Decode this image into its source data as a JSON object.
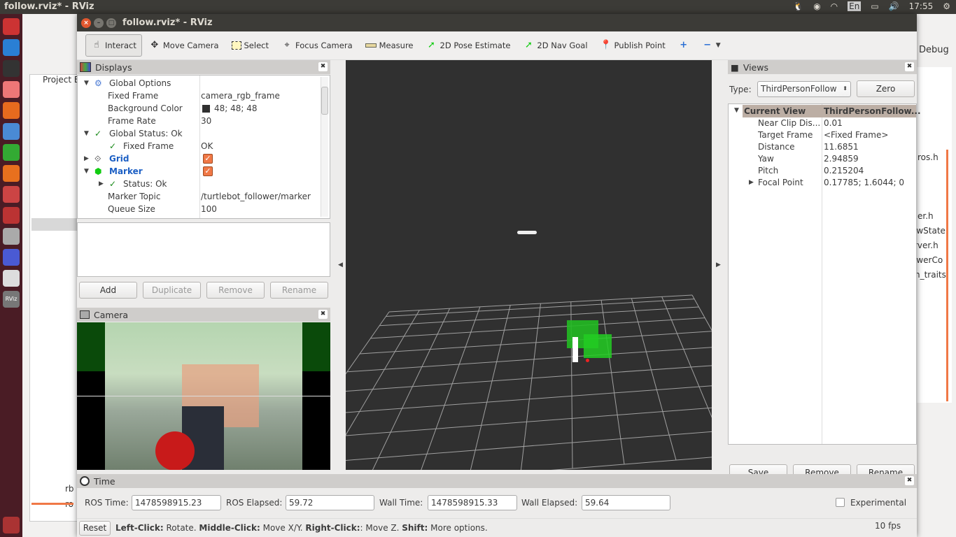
{
  "os": {
    "window_title": "follow.rviz* - RViz",
    "keyboard": "En",
    "clock": "17:55"
  },
  "ide": {
    "project_explorer": "Project E",
    "menu_debug": "Debug",
    "files": [
      "ros.h",
      "er.h",
      "owState",
      "rver.h",
      "owerCo",
      "h_traits"
    ],
    "tree_bottom": [
      "rb",
      "ro"
    ]
  },
  "rviz": {
    "title": "follow.rviz* - RViz",
    "toolbar": [
      "Interact",
      "Move Camera",
      "Select",
      "Focus Camera",
      "Measure",
      "2D Pose Estimate",
      "2D Nav Goal",
      "Publish Point"
    ],
    "displays": {
      "title": "Displays",
      "rows": [
        {
          "name": "Global Options",
          "value": ""
        },
        {
          "name": "Fixed Frame",
          "value": "camera_rgb_frame"
        },
        {
          "name": "Background Color",
          "value": "48; 48; 48"
        },
        {
          "name": "Frame Rate",
          "value": "30"
        },
        {
          "name": "Global Status: Ok",
          "value": ""
        },
        {
          "name": "Fixed Frame",
          "value": "OK"
        },
        {
          "name": "Grid",
          "value": ""
        },
        {
          "name": "Marker",
          "value": ""
        },
        {
          "name": "Status: Ok",
          "value": ""
        },
        {
          "name": "Marker Topic",
          "value": "/turtlebot_follower/marker"
        },
        {
          "name": "Queue Size",
          "value": "100"
        }
      ],
      "grid_enabled": true,
      "marker_enabled": true,
      "buttons": {
        "add": "Add",
        "duplicate": "Duplicate",
        "remove": "Remove",
        "rename": "Rename"
      }
    },
    "camera": {
      "title": "Camera"
    },
    "views": {
      "title": "Views",
      "type_label": "Type:",
      "type_value": "ThirdPersonFollow",
      "zero": "Zero",
      "header": {
        "name": "Current View",
        "value": "ThirdPersonFollow..."
      },
      "rows": [
        {
          "name": "Near Clip Dis...",
          "value": "0.01"
        },
        {
          "name": "Target Frame",
          "value": "<Fixed Frame>"
        },
        {
          "name": "Distance",
          "value": "11.6851"
        },
        {
          "name": "Yaw",
          "value": "2.94859"
        },
        {
          "name": "Pitch",
          "value": "0.215204"
        },
        {
          "name": "Focal Point",
          "value": "0.17785; 1.6044; 0"
        }
      ],
      "buttons": {
        "save": "Save",
        "remove": "Remove",
        "rename": "Rename"
      }
    },
    "time": {
      "title": "Time",
      "ros_time_label": "ROS Time:",
      "ros_time": "1478598915.23",
      "ros_elapsed_label": "ROS Elapsed:",
      "ros_elapsed": "59.72",
      "wall_time_label": "Wall Time:",
      "wall_time": "1478598915.33",
      "wall_elapsed_label": "Wall Elapsed:",
      "wall_elapsed": "59.64",
      "experimental": "Experimental",
      "experimental_checked": false
    },
    "status": {
      "reset": "Reset",
      "hint_parts": [
        {
          "b": "Left-Click:",
          "t": " Rotate. "
        },
        {
          "b": "Middle-Click:",
          "t": " Move X/Y. "
        },
        {
          "b": "Right-Click:",
          "t": ": Move Z. "
        },
        {
          "b": "Shift:",
          "t": " More options."
        }
      ],
      "fps": "10 fps"
    },
    "colors": {
      "background": "#303030",
      "grid": "#a0a0a0",
      "marker": "#22cc22"
    }
  }
}
